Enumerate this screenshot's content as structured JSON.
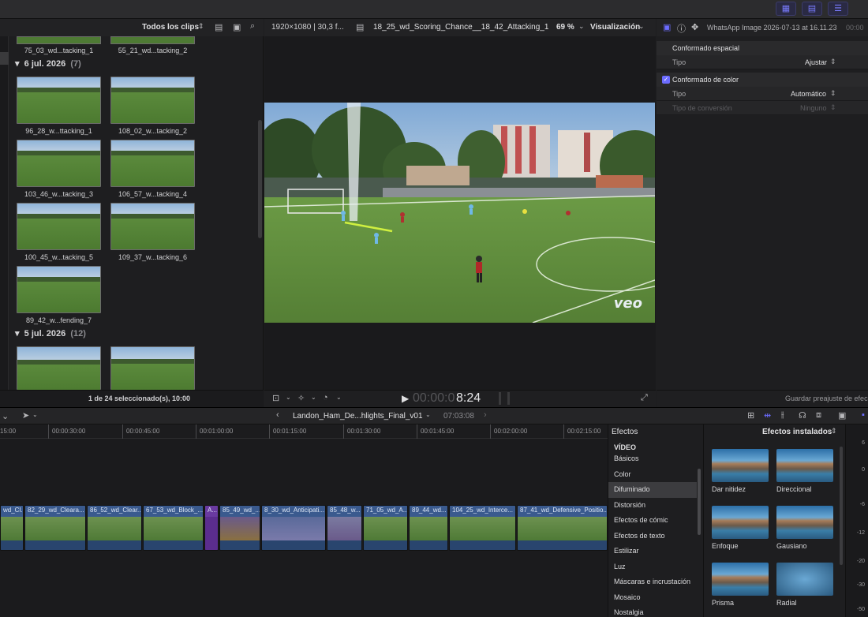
{
  "browser": {
    "filter_label": "Todos los clips",
    "top_labels": [
      "75_03_wd...tacking_1",
      "55_21_wd...tacking_2"
    ],
    "groups": [
      {
        "date": "6 jul. 2026",
        "count": "(7)",
        "clips": [
          "96_28_w...ttacking_1",
          "108_02_w...tacking_2",
          "103_46_w...tacking_3",
          "106_57_w...tacking_4",
          "100_45_w...tacking_5",
          "109_37_w...tacking_6",
          "89_42_w...fending_7"
        ]
      },
      {
        "date": "5 jul. 2026",
        "count": "(12)"
      }
    ],
    "footer": "1 de 24 seleccionado(s), 10:00"
  },
  "viewer": {
    "format": "1920×1080 | 30,3 f...",
    "clip_name": "18_25_wd_Scoring_Chance__18_42_Attacking_1",
    "zoom": "69 %",
    "view_label": "Visualización",
    "timecode_dim": "00:00:0",
    "timecode_bright": "8:24",
    "watermark": "veo"
  },
  "inspector": {
    "title": "WhatsApp Image 2026-07-13 at 16.11.23",
    "title_suffix": "00:00",
    "spatial_section": "Conformado espacial",
    "spatial_type_label": "Tipo",
    "spatial_type_value": "Ajustar",
    "color_section": "Conformado de color",
    "color_type_label": "Tipo",
    "color_type_value": "Automático",
    "conversion_label": "Tipo de conversión",
    "conversion_value": "Ninguno",
    "save_preset": "Guardar preajuste de efec"
  },
  "timeline": {
    "project": "Landon_Ham_De...hlights_Final_v01",
    "duration": "07:03:08",
    "ruler": [
      "15:00",
      "00:00:30:00",
      "00:00:45:00",
      "00:01:00:00",
      "00:01:15:00",
      "00:01:30:00",
      "00:01:45:00",
      "00:02:00:00",
      "00:02:15:00"
    ],
    "clips": [
      "wd_Cl...",
      "82_29_wd_Cleara...",
      "86_52_wd_Clear...",
      "67_53_wd_Block_...",
      "A...",
      "85_49_wd_...",
      "8_30_wd_Anticipati...",
      "85_48_w...",
      "71_05_wd_A...",
      "89_44_wd...",
      "104_25_wd_Interce...",
      "87_41_wd_Defensive_Positio..."
    ]
  },
  "effects": {
    "header": "Efectos",
    "installed": "Efectos instalados",
    "category_header": "VÍDEO",
    "categories": [
      "Básicos",
      "Color",
      "Difuminado",
      "Distorsión",
      "Efectos de cómic",
      "Efectos de texto",
      "Estilizar",
      "Luz",
      "Máscaras e incrustación",
      "Mosaico",
      "Nostalgia"
    ],
    "selected_category": "Difuminado",
    "items": [
      "Dar nitidez",
      "Direccional",
      "Enfoque",
      "Gausiano",
      "Prisma",
      "Radial"
    ]
  },
  "meter": {
    "labels": [
      "6",
      "0",
      "-6",
      "-12",
      "-20",
      "-30",
      "-50"
    ]
  },
  "colors": {
    "accent": "#6c6cff",
    "selected_clip": "#5b2d8e",
    "clip_blue": "#2d4a78"
  }
}
